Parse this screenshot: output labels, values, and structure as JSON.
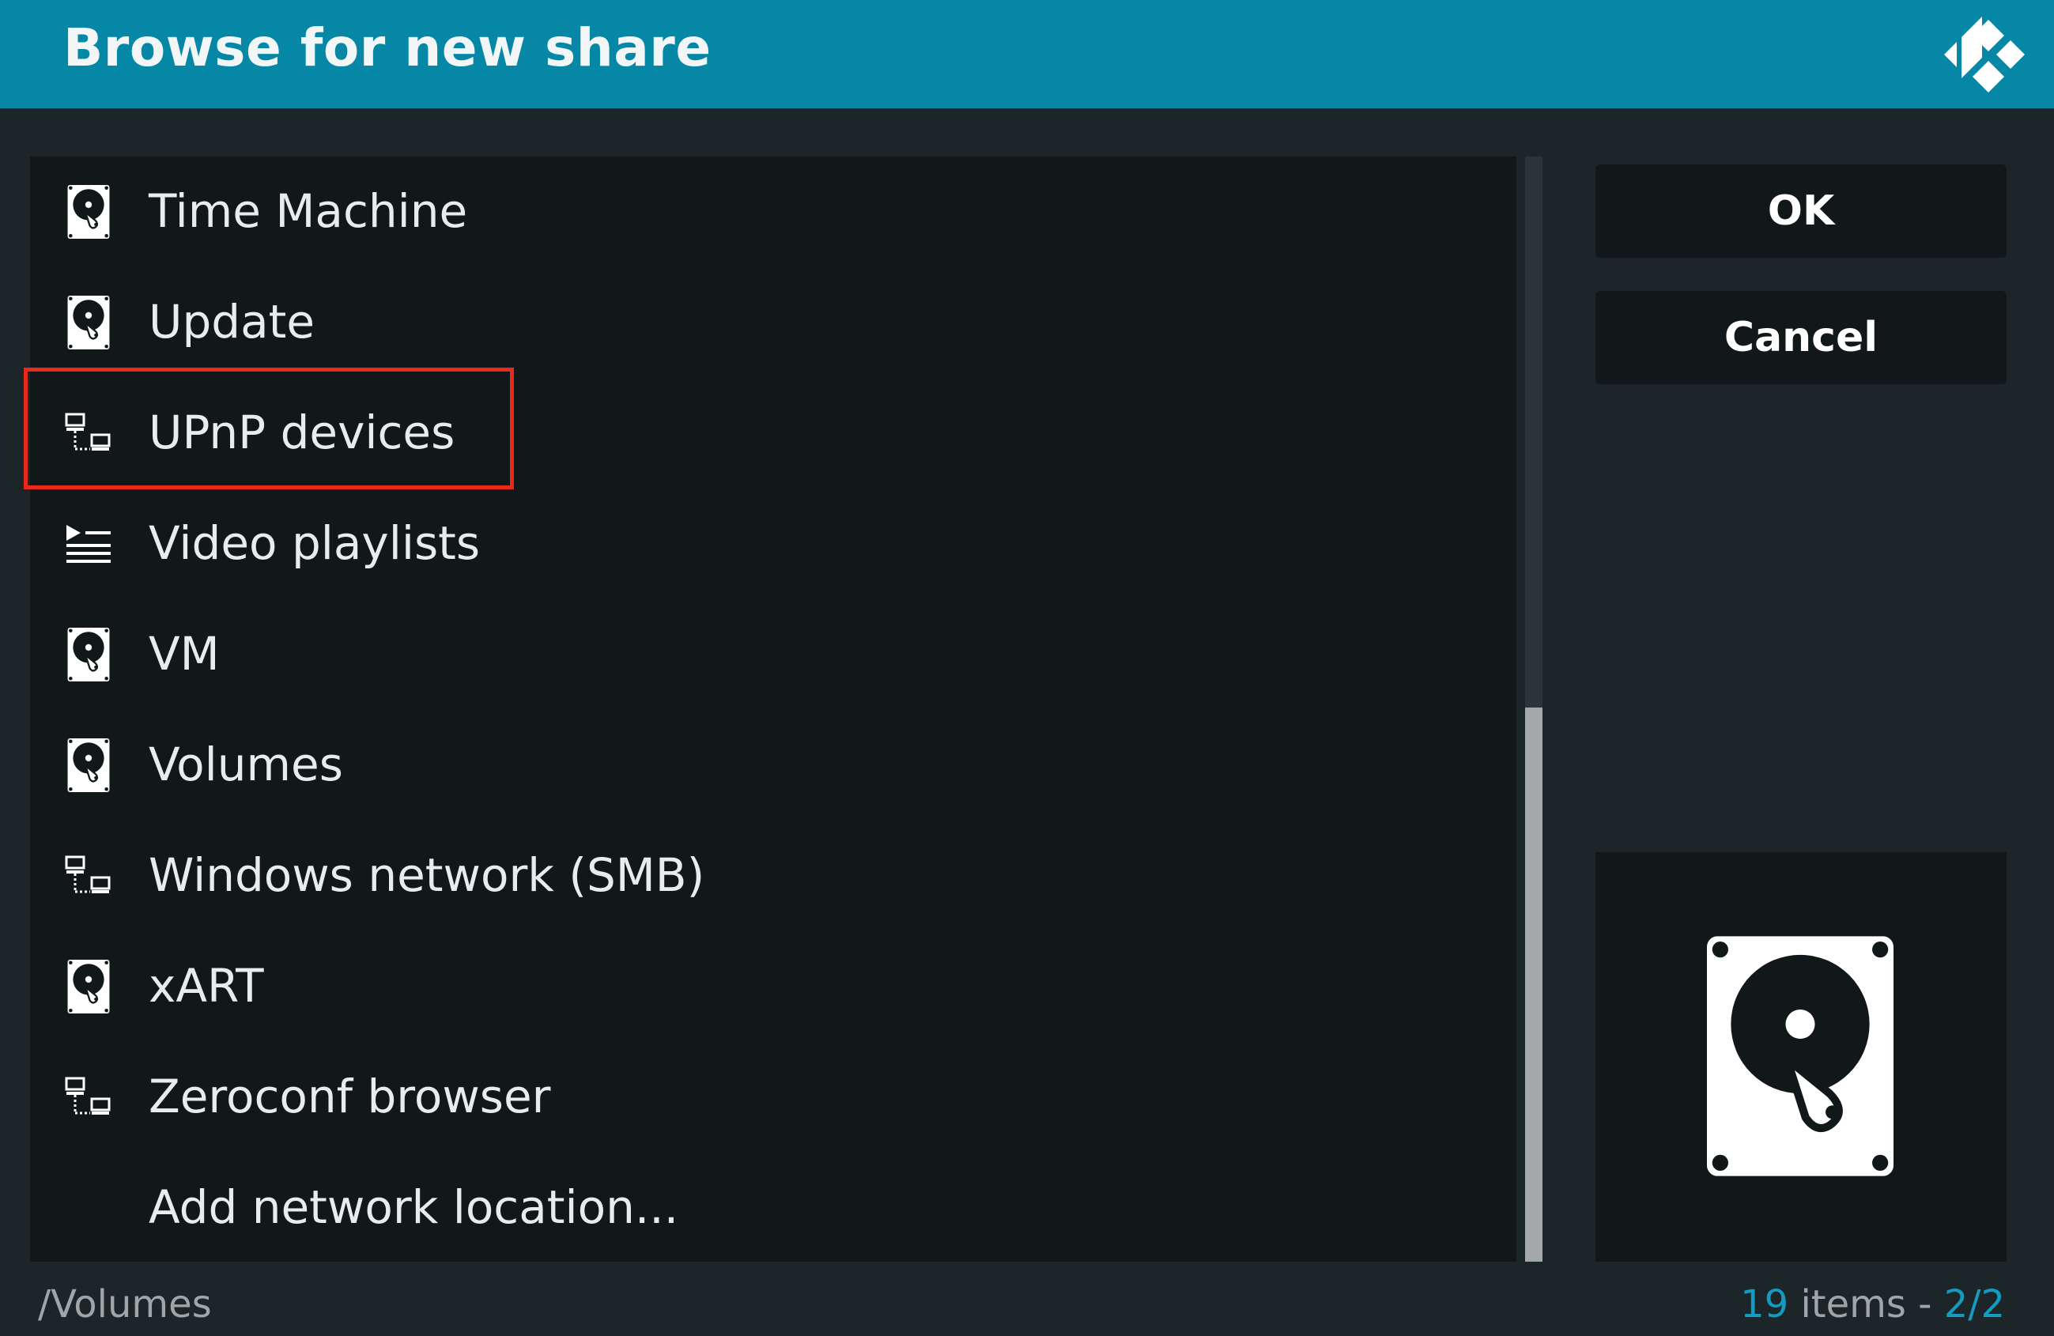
{
  "header": {
    "title": "Browse for new share",
    "logo_icon": "kodi-logo-icon"
  },
  "list": {
    "items": [
      {
        "label": "Time Machine",
        "icon": "hard-drive-icon"
      },
      {
        "label": "Update",
        "icon": "hard-drive-icon"
      },
      {
        "label": "UPnP devices",
        "icon": "network-icon",
        "highlighted": true
      },
      {
        "label": "Video playlists",
        "icon": "playlist-icon"
      },
      {
        "label": "VM",
        "icon": "hard-drive-icon"
      },
      {
        "label": "Volumes",
        "icon": "hard-drive-icon"
      },
      {
        "label": "Windows network (SMB)",
        "icon": "network-icon"
      },
      {
        "label": "xART",
        "icon": "hard-drive-icon"
      },
      {
        "label": "Zeroconf browser",
        "icon": "network-icon"
      },
      {
        "label": "Add network location...",
        "icon": ""
      }
    ]
  },
  "buttons": {
    "ok": "OK",
    "cancel": "Cancel"
  },
  "preview": {
    "icon": "hard-drive-icon"
  },
  "footer": {
    "path": "/Volumes",
    "count_number": "19",
    "count_word": " items - ",
    "page": "2/2"
  },
  "colors": {
    "header": "#0787a6",
    "background": "#1c2527",
    "panel": "#121819",
    "highlight": "#e8291c",
    "accent": "#139bc2"
  }
}
